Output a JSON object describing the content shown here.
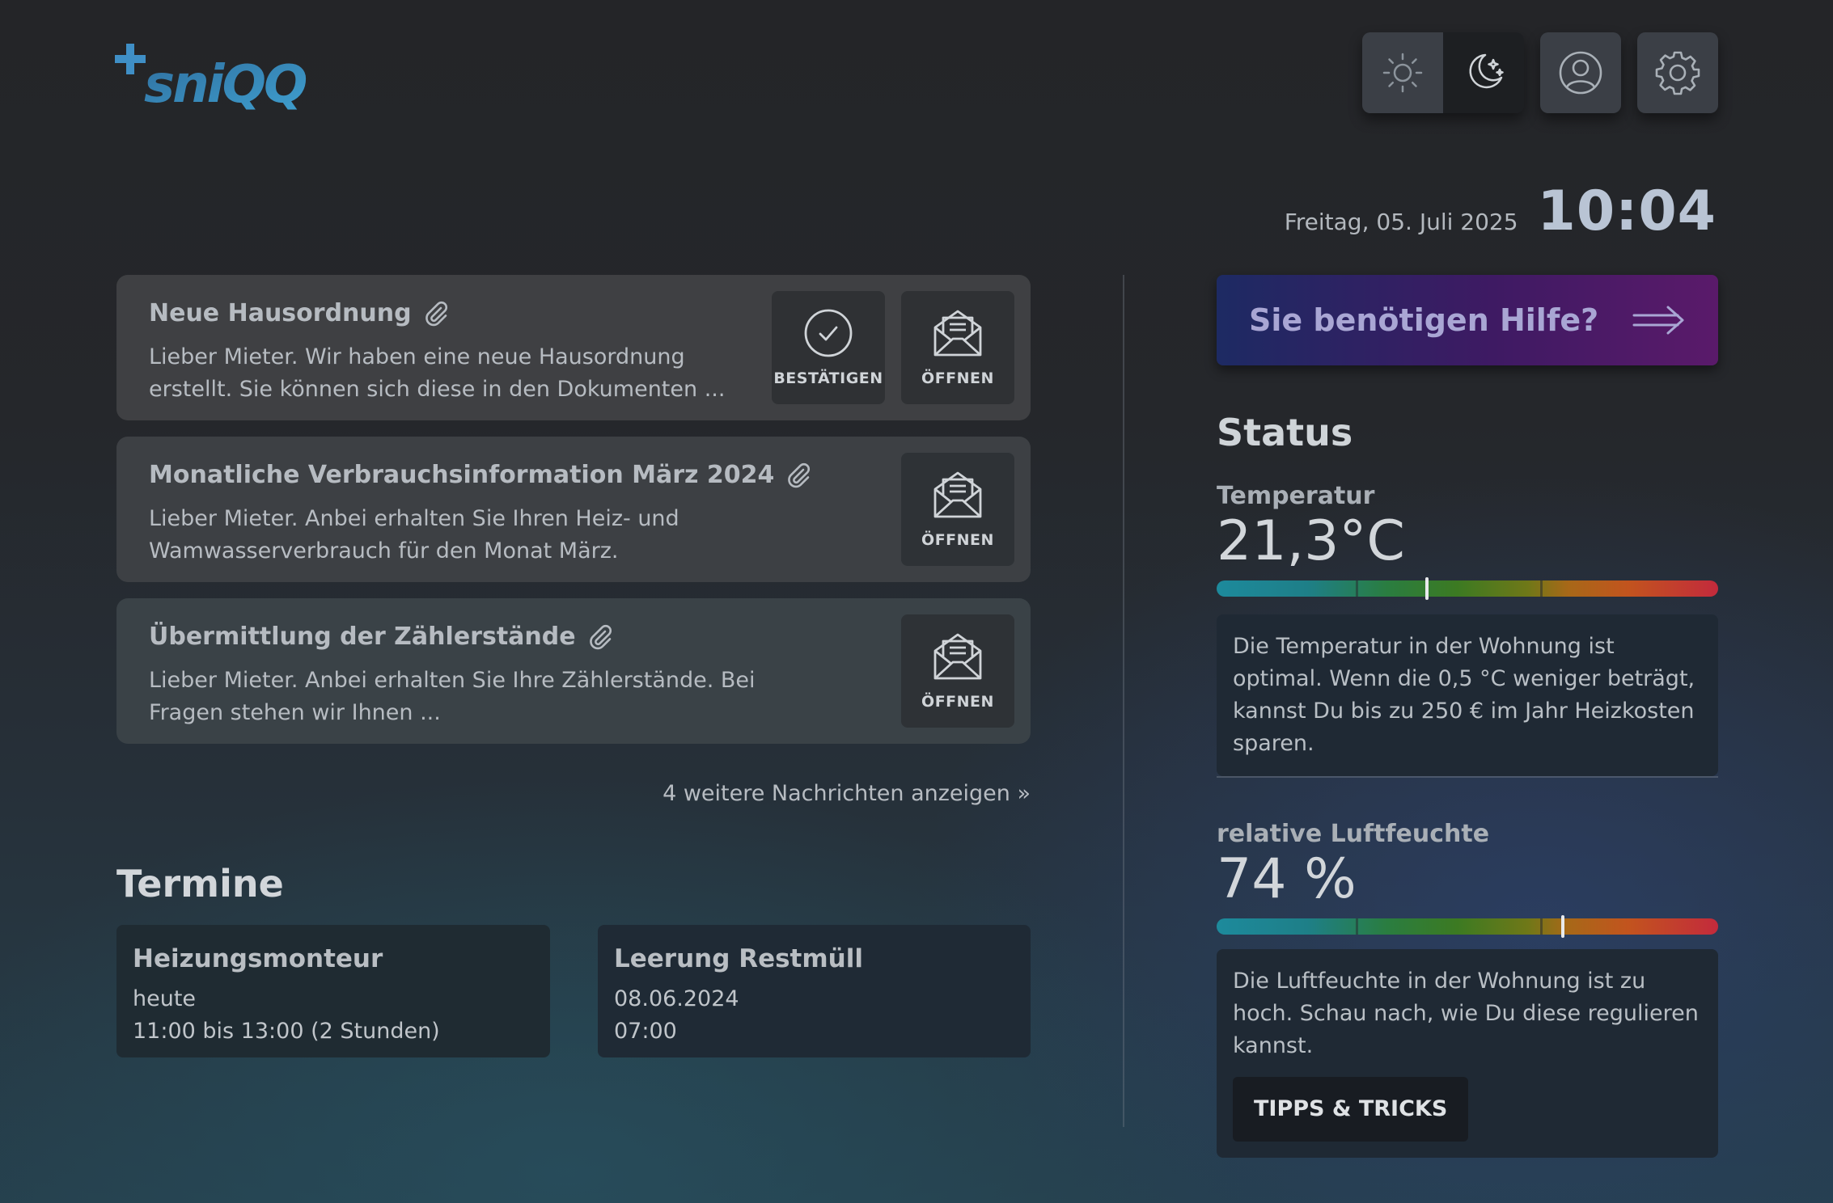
{
  "brand": {
    "logo_text": "sniQQ"
  },
  "header": {
    "date": "Freitag, 05. Juli 2025",
    "time": "10:04"
  },
  "messages": [
    {
      "title": "Neue Hausordnung",
      "text": "Lieber Mieter. Wir haben eine neue Hausordnung erstellt. Sie können sich diese in den Dokumenten ...",
      "confirm_label": "BESTÄTIGEN",
      "open_label": "ÖFFNEN"
    },
    {
      "title": "Monatliche Verbrauchsinformation März 2024",
      "text": "Lieber Mieter. Anbei erhalten Sie Ihren Heiz- und Wamwasserverbrauch für den Monat März.",
      "open_label": "ÖFFNEN"
    },
    {
      "title": "Übermittlung der Zählerstände",
      "text": "Lieber Mieter. Anbei erhalten Sie Ihre Zählerstände. Bei Fragen stehen wir Ihnen ...",
      "open_label": "ÖFFNEN"
    }
  ],
  "more_messages": "4 weitere Nachrichten anzeigen »",
  "appointments": {
    "heading": "Termine",
    "items": [
      {
        "title": "Heizungsmonteur",
        "line1": "heute",
        "line2": "11:00 bis 13:00 (2 Stunden)"
      },
      {
        "title": "Leerung Restmüll",
        "line1": "08.06.2024",
        "line2": "07:00"
      }
    ]
  },
  "help": {
    "label": "Sie benötigen Hilfe?"
  },
  "status": {
    "heading": "Status",
    "temperature": {
      "label": "Temperatur",
      "value": "21,3°C",
      "gauge_level": 0.42,
      "info": "Die Temperatur in der Wohnung ist optimal. Wenn die 0,5 °C weniger beträgt, kannst Du bis zu 250 € im Jahr Heizkosten sparen."
    },
    "humidity": {
      "label": "relative Luftfeuchte",
      "value": "74 %",
      "gauge_level": 0.69,
      "info": "Die Luftfeuchte in der Wohnung ist zu hoch. Schau nach, wie Du diese regulieren kannst.",
      "tips_label": "TIPPS & TRICKS"
    }
  },
  "colors": {
    "accent_blue": "#3a8fc4",
    "help_gradient_start": "#1d2a63",
    "help_gradient_end": "#5a1a6a",
    "card_bg": "#3f4043"
  },
  "icons": [
    "sun-icon",
    "moon-icon",
    "user-icon",
    "gear-icon",
    "paperclip-icon",
    "check-circle-icon",
    "envelope-open-icon",
    "arrow-right-icon"
  ]
}
